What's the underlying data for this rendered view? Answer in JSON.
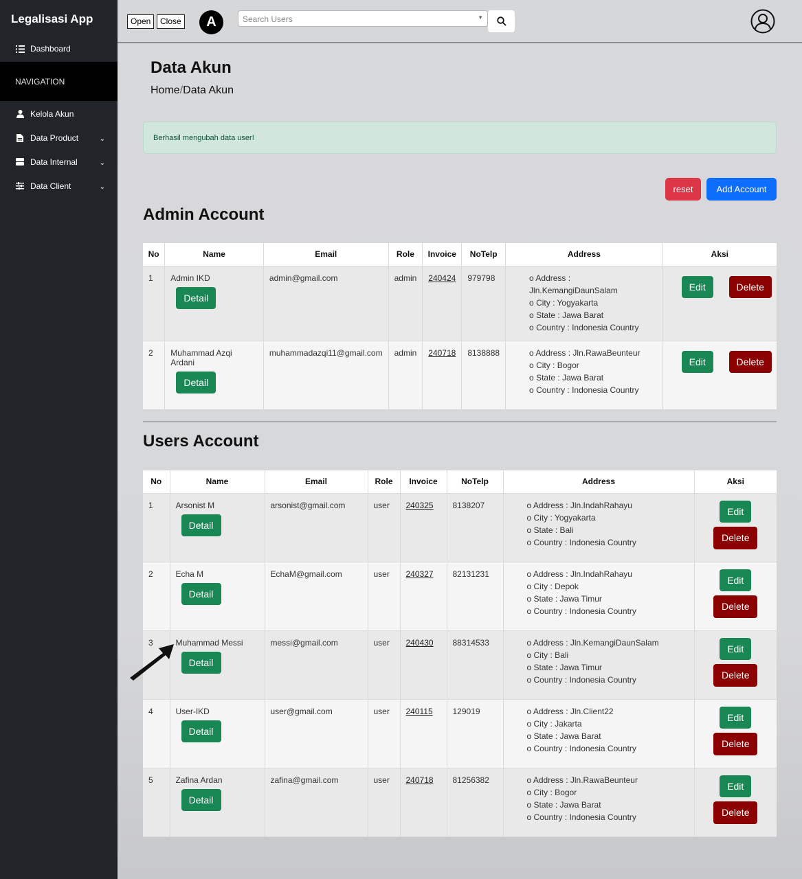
{
  "sidebar": {
    "brand": "Legalisasi App",
    "dashboard": "Dashboard",
    "nav_heading": "NAVIGATION",
    "items": [
      {
        "label": "Kelola Akun",
        "icon": "user-icon"
      },
      {
        "label": "Data Product",
        "icon": "file-icon"
      },
      {
        "label": "Data Internal",
        "icon": "server-icon"
      },
      {
        "label": "Data Client",
        "icon": "sliders-icon"
      }
    ]
  },
  "topbar": {
    "open": "Open",
    "close": "Close",
    "logo_letter": "A",
    "search_placeholder": "Search Users"
  },
  "page": {
    "title": "Data Akun",
    "crumb_home": "Home",
    "crumb_sep": "/",
    "crumb_current": "Data Akun",
    "alert": "Berhasil mengubah data user!",
    "reset": "reset",
    "add_account": "Add Account",
    "admin_title": "Admin Account",
    "users_title": "Users Account",
    "detail": "Detail",
    "edit": "Edit",
    "delete": "Delete"
  },
  "columns": [
    "No",
    "Name",
    "Email",
    "Role",
    "Invoice",
    "NoTelp",
    "Address",
    "Aksi"
  ],
  "admins": [
    {
      "no": "1",
      "name": "Admin IKD",
      "email": "admin@gmail.com",
      "role": "admin",
      "invoice": "240424",
      "telp": "979798",
      "addr": [
        "Address : Jln.KemangiDaunSalam",
        "City : Yogyakarta",
        "State : Jawa Barat",
        "Country : Indonesia Country"
      ]
    },
    {
      "no": "2",
      "name": "Muhammad Azqi Ardani",
      "email": "muhammadazqi11@gmail.com",
      "role": "admin",
      "invoice": "240718",
      "telp": "8138888",
      "addr": [
        "Address : Jln.RawaBeunteur",
        "City : Bogor",
        "State : Jawa Barat",
        "Country : Indonesia Country"
      ]
    }
  ],
  "users": [
    {
      "no": "1",
      "name": "Arsonist M",
      "email": "arsonist@gmail.com",
      "role": "user",
      "invoice": "240325",
      "telp": "8138207",
      "addr": [
        "Address : Jln.IndahRahayu",
        "City : Yogyakarta",
        "State : Bali",
        "Country : Indonesia Country"
      ]
    },
    {
      "no": "2",
      "name": "Echa M",
      "email": "EchaM@gmail.com",
      "role": "user",
      "invoice": "240327",
      "telp": "82131231",
      "addr": [
        "Address : Jln.IndahRahayu",
        "City : Depok",
        "State : Jawa Timur",
        "Country : Indonesia Country"
      ]
    },
    {
      "no": "3",
      "name": "Muhammad Messi",
      "email": "messi@gmail.com",
      "role": "user",
      "invoice": "240430",
      "telp": "88314533",
      "addr": [
        "Address : Jln.KemangiDaunSalam",
        "City : Bali",
        "State : Jawa Timur",
        "Country : Indonesia Country"
      ]
    },
    {
      "no": "4",
      "name": "User-IKD",
      "email": "user@gmail.com",
      "role": "user",
      "invoice": "240115",
      "telp": "129019",
      "addr": [
        "Address : Jln.Client22",
        "City : Jakarta",
        "State : Jawa Barat",
        "Country : Indonesia Country"
      ]
    },
    {
      "no": "5",
      "name": "Zafina Ardan",
      "email": "zafina@gmail.com",
      "role": "user",
      "invoice": "240718",
      "telp": "81256382",
      "addr": [
        "Address : Jln.RawaBeunteur",
        "City : Bogor",
        "State : Jawa Barat",
        "Country : Indonesia Country"
      ]
    }
  ],
  "colors": {
    "sidebar": "#212529",
    "detail": "#198754",
    "edit": "#198754",
    "delete": "#8b0000",
    "reset": "#dc3545",
    "add": "#0d6efd",
    "alert_bg": "#d1e7dd"
  }
}
